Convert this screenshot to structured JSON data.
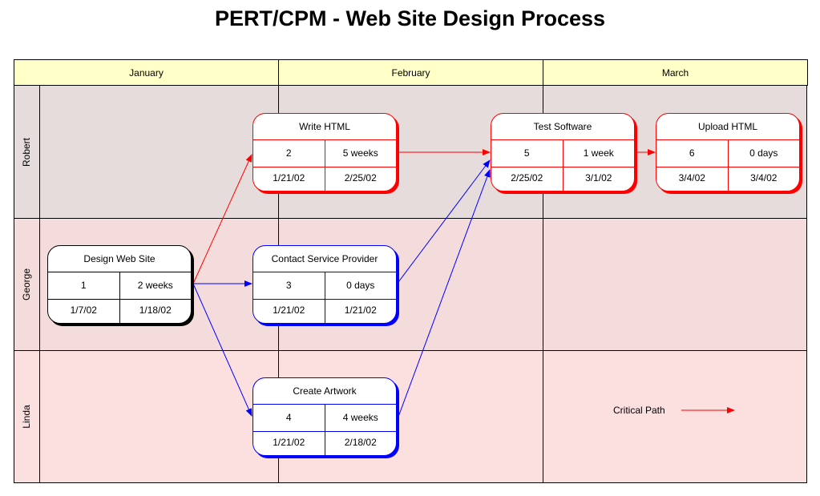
{
  "title": "PERT/CPM - Web Site Design Process",
  "colors": {
    "header_bg": "#ffffc8",
    "lane_robert_bg": "#e6dcdc",
    "lane_george_bg": "#f5dcdc",
    "lane_linda_bg": "#fce0e0",
    "critical": "#ff0000",
    "normal": "#0000ff",
    "start": "#000000"
  },
  "columns": [
    "January",
    "February",
    "March"
  ],
  "lanes": [
    "Robert",
    "George",
    "Linda"
  ],
  "tasks": [
    {
      "id": 1,
      "name": "Design Web Site",
      "number": "1",
      "duration": "2 weeks",
      "start": "1/7/02",
      "finish": "1/18/02",
      "lane": "George",
      "style": "black"
    },
    {
      "id": 2,
      "name": "Write HTML",
      "number": "2",
      "duration": "5 weeks",
      "start": "1/21/02",
      "finish": "2/25/02",
      "lane": "Robert",
      "style": "red"
    },
    {
      "id": 3,
      "name": "Contact Service Provider",
      "number": "3",
      "duration": "0 days",
      "start": "1/21/02",
      "finish": "1/21/02",
      "lane": "George",
      "style": "blue"
    },
    {
      "id": 4,
      "name": "Create Artwork",
      "number": "4",
      "duration": "4 weeks",
      "start": "1/21/02",
      "finish": "2/18/02",
      "lane": "Linda",
      "style": "blue"
    },
    {
      "id": 5,
      "name": "Test Software",
      "number": "5",
      "duration": "1 week",
      "start": "2/25/02",
      "finish": "3/1/02",
      "lane": "Robert",
      "style": "red"
    },
    {
      "id": 6,
      "name": "Upload HTML",
      "number": "6",
      "duration": "0 days",
      "start": "3/4/02",
      "finish": "3/4/02",
      "lane": "Robert",
      "style": "red"
    }
  ],
  "links": [
    {
      "from": 1,
      "to": 2,
      "critical": true
    },
    {
      "from": 1,
      "to": 3,
      "critical": false
    },
    {
      "from": 1,
      "to": 4,
      "critical": false
    },
    {
      "from": 2,
      "to": 5,
      "critical": true
    },
    {
      "from": 3,
      "to": 5,
      "critical": false
    },
    {
      "from": 4,
      "to": 5,
      "critical": false
    },
    {
      "from": 5,
      "to": 6,
      "critical": true
    }
  ],
  "legend": {
    "label": "Critical Path",
    "icon": "red-arrow-icon"
  }
}
